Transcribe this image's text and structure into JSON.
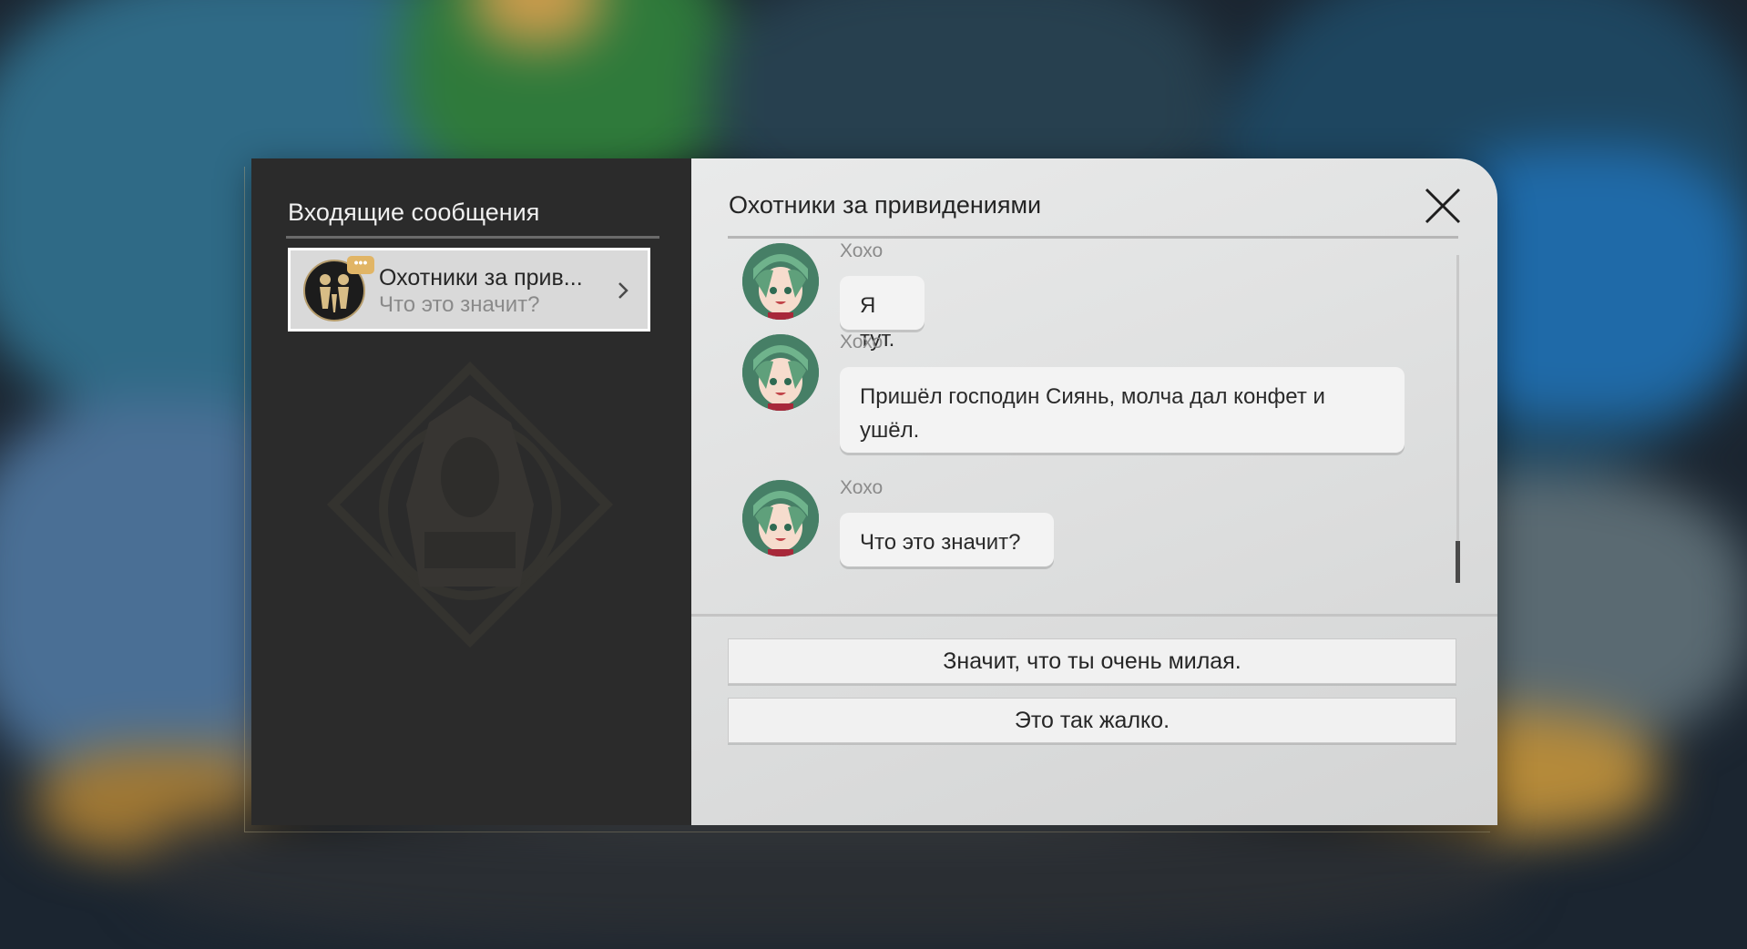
{
  "inbox": {
    "title": "Входящие сообщения",
    "conversations": [
      {
        "name": "Охотники за прив...",
        "preview": "Что это значит?",
        "badge": "•••",
        "avatar_icon": "ghost-hunters-emblem-icon"
      }
    ]
  },
  "chat": {
    "title": "Охотники за привидениями",
    "close_icon": "close-icon",
    "messages": [
      {
        "sender": "Хохо",
        "text": "Я тут."
      },
      {
        "sender": "Хохо",
        "text": "Пришёл господин Сиянь, молча дал конфет и ушёл."
      },
      {
        "sender": "Хохо",
        "text": "Что это значит?"
      }
    ],
    "replies": [
      "Значит, что ты очень милая.",
      "Это так жалко."
    ]
  },
  "colors": {
    "left_panel": "#2b2b2b",
    "right_panel": "#e6e7e7",
    "badge": "#e1b566",
    "emblem_gold": "#b59c6c"
  }
}
